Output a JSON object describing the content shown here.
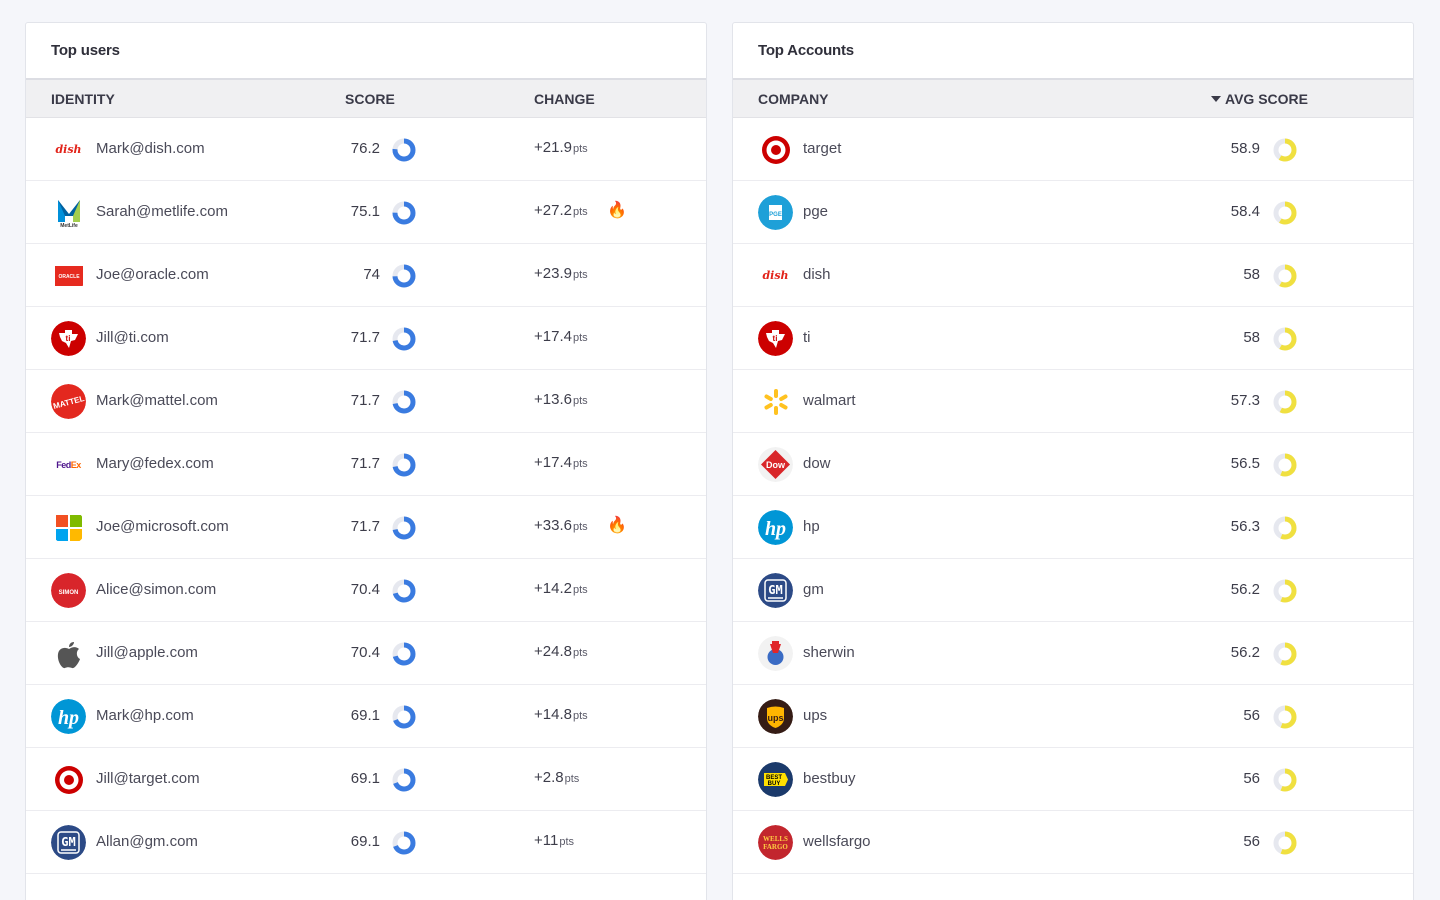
{
  "users": {
    "title": "Top users",
    "headers": {
      "identity": "IDENTITY",
      "score": "SCORE",
      "change": "CHANGE"
    },
    "pts_label": "pts",
    "rows": [
      {
        "email": "Mark@dish.com",
        "score": "76.2",
        "score_value": 76.2,
        "change": "+21.9",
        "hot": false,
        "logo": "dish-logo"
      },
      {
        "email": "Sarah@metlife.com",
        "score": "75.1",
        "score_value": 75.1,
        "change": "+27.2",
        "hot": true,
        "logo": "metlife-logo"
      },
      {
        "email": "Joe@oracle.com",
        "score": "74",
        "score_value": 74,
        "change": "+23.9",
        "hot": false,
        "logo": "oracle-logo"
      },
      {
        "email": "Jill@ti.com",
        "score": "71.7",
        "score_value": 71.7,
        "change": "+17.4",
        "hot": false,
        "logo": "ti-logo"
      },
      {
        "email": "Mark@mattel.com",
        "score": "71.7",
        "score_value": 71.7,
        "change": "+13.6",
        "hot": false,
        "logo": "mattel-logo"
      },
      {
        "email": "Mary@fedex.com",
        "score": "71.7",
        "score_value": 71.7,
        "change": "+17.4",
        "hot": false,
        "logo": "fedex-logo"
      },
      {
        "email": "Joe@microsoft.com",
        "score": "71.7",
        "score_value": 71.7,
        "change": "+33.6",
        "hot": true,
        "logo": "microsoft-logo"
      },
      {
        "email": "Alice@simon.com",
        "score": "70.4",
        "score_value": 70.4,
        "change": "+14.2",
        "hot": false,
        "logo": "simon-logo"
      },
      {
        "email": "Jill@apple.com",
        "score": "70.4",
        "score_value": 70.4,
        "change": "+24.8",
        "hot": false,
        "logo": "apple-logo"
      },
      {
        "email": "Mark@hp.com",
        "score": "69.1",
        "score_value": 69.1,
        "change": "+14.8",
        "hot": false,
        "logo": "hp-logo"
      },
      {
        "email": "Jill@target.com",
        "score": "69.1",
        "score_value": 69.1,
        "change": "+2.8",
        "hot": false,
        "logo": "target-logo"
      },
      {
        "email": "Allan@gm.com",
        "score": "69.1",
        "score_value": 69.1,
        "change": "+11",
        "hot": false,
        "logo": "gm-logo"
      }
    ]
  },
  "accounts": {
    "title": "Top Accounts",
    "headers": {
      "company": "COMPANY",
      "avg_score": "AVG SCORE"
    },
    "rows": [
      {
        "company": "target",
        "score": "58.9",
        "score_value": 58.9,
        "logo": "target-logo"
      },
      {
        "company": "pge",
        "score": "58.4",
        "score_value": 58.4,
        "logo": "pge-logo"
      },
      {
        "company": "dish",
        "score": "58",
        "score_value": 58,
        "logo": "dish-logo"
      },
      {
        "company": "ti",
        "score": "58",
        "score_value": 58,
        "logo": "ti-logo"
      },
      {
        "company": "walmart",
        "score": "57.3",
        "score_value": 57.3,
        "logo": "walmart-logo"
      },
      {
        "company": "dow",
        "score": "56.5",
        "score_value": 56.5,
        "logo": "dow-logo"
      },
      {
        "company": "hp",
        "score": "56.3",
        "score_value": 56.3,
        "logo": "hp-logo"
      },
      {
        "company": "gm",
        "score": "56.2",
        "score_value": 56.2,
        "logo": "gm-logo"
      },
      {
        "company": "sherwin",
        "score": "56.2",
        "score_value": 56.2,
        "logo": "sherwin-logo"
      },
      {
        "company": "ups",
        "score": "56",
        "score_value": 56,
        "logo": "ups-logo"
      },
      {
        "company": "bestbuy",
        "score": "56",
        "score_value": 56,
        "logo": "bestbuy-logo"
      },
      {
        "company": "wellsfargo",
        "score": "56",
        "score_value": 56,
        "logo": "wellsfargo-logo"
      }
    ]
  },
  "colors": {
    "user_ring": "#3a7be0",
    "account_ring": "#f0e040",
    "ring_track": "#e6e8ef",
    "fire": "#f07818"
  }
}
